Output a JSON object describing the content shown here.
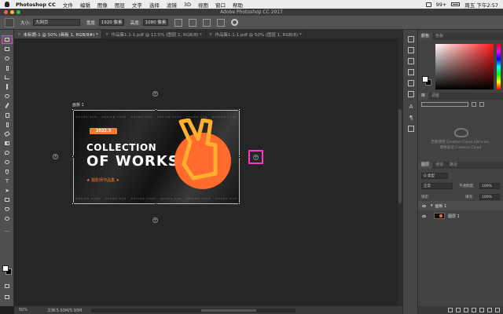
{
  "menubar": {
    "app_name": "Photoshop CC",
    "items": [
      "文件",
      "编辑",
      "图像",
      "图层",
      "文字",
      "选择",
      "滤镜",
      "3D",
      "视图",
      "窗口",
      "帮助"
    ],
    "battery": "99+",
    "clock": "周五 下午2:57"
  },
  "window": {
    "title": "Adobe Photoshop CC 2017"
  },
  "options_bar": {
    "size_label": "大小:",
    "size_value": "大网页",
    "width_label": "宽度:",
    "width_value": "1920 像素",
    "height_label": "高度:",
    "height_value": "1080 像素"
  },
  "tabs": [
    {
      "label": "未标题-1 @ 50% (画板 1, RGB/8#) *",
      "active": true
    },
    {
      "label": "作品集1.1-1.pdf @ 12.5% (图层 1, RGB/8) *",
      "active": false
    },
    {
      "label": "作品集1.1-1.pdf @ 50% (图层 1, RGB/8) *",
      "active": false
    }
  ],
  "artboard": {
    "label": "画板 1",
    "pill": "2022.3",
    "title_line1": "COLLECTION",
    "title_line2": "OF WORKS",
    "subtitle": "★ 摄影师作品集 ★",
    "ticker_top": "ZHANG SAN · DESIGN CASE · ZHANG SAN · DESIGN CASE · ZHANG SAN · DESIGN CASE",
    "ticker_bottom": "DESIGN CASE · ZHANG SAN · DESIGN CASE · ZHANG SAN · DESIGN CASE · ZHANG SAN"
  },
  "status": {
    "zoom": "50%",
    "doc": "文档:5.93M/5.93M"
  },
  "panels": {
    "color_tabs": [
      "颜色",
      "色板"
    ],
    "library_tabs": [
      "库",
      "调整"
    ],
    "library_message_line1": "若要使用 Creative Cloud Libraries,",
    "library_message_line2": "需要安装 Creative Cloud",
    "layers_tabs": [
      "图层",
      "通道",
      "路径"
    ],
    "kind_label": "Q 类型",
    "blend_mode": "正常",
    "opacity_label": "不透明度:",
    "opacity_value": "100%",
    "lock_label": "锁定:",
    "fill_label": "填充:",
    "fill_value": "100%",
    "layers": [
      {
        "name": "画板 1",
        "type": "group"
      },
      {
        "name": "图层 1",
        "type": "layer"
      }
    ]
  },
  "colors": {
    "accent": "#ff7a2c",
    "highlight": "#ff36c6"
  }
}
